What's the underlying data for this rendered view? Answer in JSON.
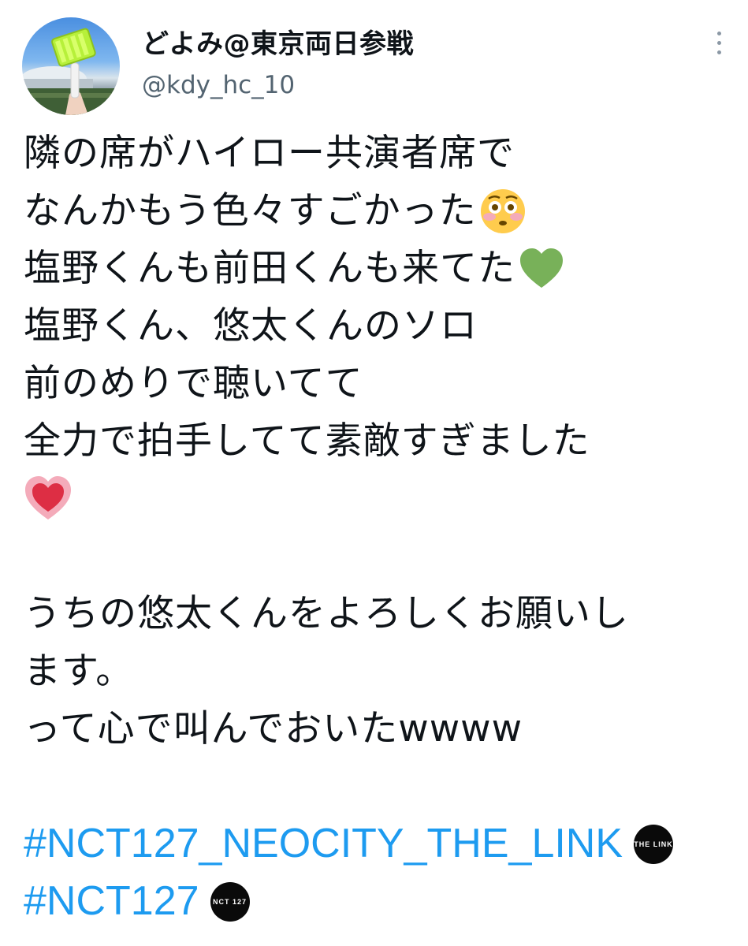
{
  "header": {
    "display_name": "どよみ@東京両日参戦",
    "handle": "@kdy_hc_10"
  },
  "icons": {
    "avatar": "avatar-photo-lightstick-stadium",
    "more": "more-vertical-icon",
    "flushed": "flushed-face-emoji",
    "green_heart": "green-heart-emoji",
    "glowing_heart": "glowing-heart-emoji"
  },
  "body": {
    "line1": "隣の席がハイロー共演者席で",
    "line2": "なんかもう色々すごかった",
    "line3": "塩野くんも前田くんも来てた",
    "line4": "塩野くん、悠太くんのソロ",
    "line5": "前のめりで聴いてて",
    "line6": "全力で拍手してて素敵すぎました",
    "line7": "うちの悠太くんをよろしくお願いし",
    "line8": "ます。",
    "line9": "って心で叫んでおいたwwww"
  },
  "hashtags": {
    "tag1": "#NCT127_NEOCITY_THE_LINK",
    "tag1_flag": "THE LINK",
    "tag2": "#NCT127",
    "tag2_flag": "NCT 127"
  },
  "colors": {
    "text": "#0f1419",
    "secondary": "#536471",
    "link": "#1d9bf0"
  }
}
